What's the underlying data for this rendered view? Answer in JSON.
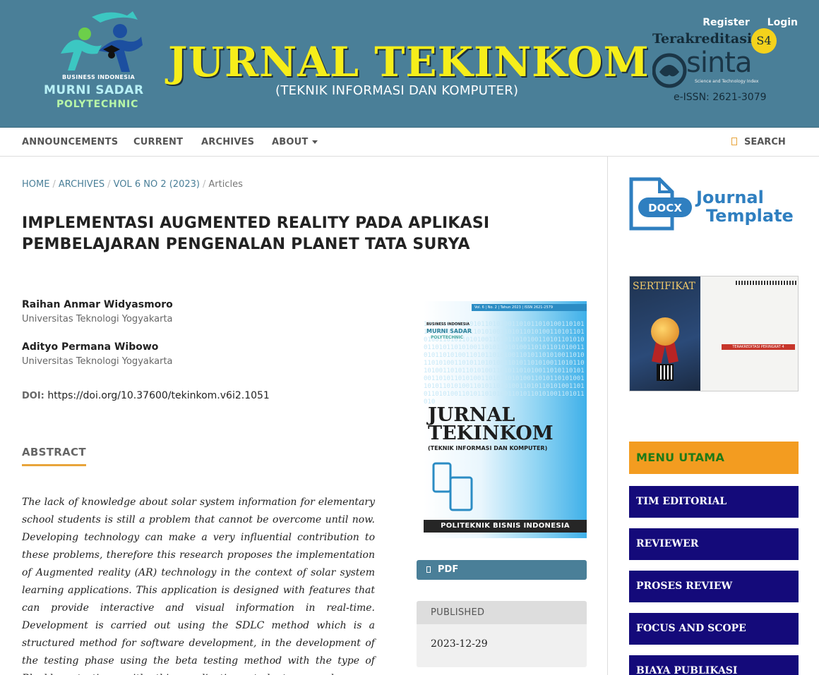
{
  "header": {
    "institution": {
      "line1": "BUSINESS INDONESIA",
      "line2": "MURNI SADAR",
      "line3": "POLYTECHNIC"
    },
    "journal_title": "JURNAL TEKINKOM",
    "journal_subtitle": "(TEKNIK INFORMASI DAN KOMPUTER)",
    "register_label": "Register",
    "login_label": "Login",
    "accreditation": {
      "label": "Terakreditasi",
      "badge": "S4",
      "sinta_word": "sinta",
      "sinta_tagline": "Science and Technology Index",
      "issn": "e-ISSN: 2621-3079"
    }
  },
  "nav": {
    "items": [
      "ANNOUNCEMENTS",
      "CURRENT",
      "ARCHIVES",
      "ABOUT"
    ],
    "search_label": "SEARCH"
  },
  "breadcrumb": {
    "home": "HOME",
    "archives": "ARCHIVES",
    "issue": "VOL 6 NO 2 (2023)",
    "section": "Articles"
  },
  "article": {
    "title": "IMPLEMENTASI AUGMENTED REALITY PADA APLIKASI PEMBELAJARAN PENGENALAN PLANET TATA SURYA",
    "authors": [
      {
        "name": "Raihan Anmar Widyasmoro",
        "affiliation": "Universitas Teknologi Yogyakarta"
      },
      {
        "name": "Adityo Permana Wibowo",
        "affiliation": "Universitas Teknologi Yogyakarta"
      }
    ],
    "doi_label": "DOI:",
    "doi_value": "https://doi.org/10.37600/tekinkom.v6i2.1051",
    "abstract_heading": "ABSTRACT",
    "abstract_text": "The lack of knowledge about solar system information for elementary school students is still a problem that cannot be overcome until now. Developing technology can make a very influential contribution to these problems, therefore this research proposes the implementation of Augmented reality (AR) technology in the context of solar system learning applications. This application is designed with features that can provide interactive and visual information in real-time. Development is carried out using the SDLC method which is a structured method for software development, in the development of the testing phase using the beta testing method with the type of Blackbox testing, with this application students can do more interesting and effective"
  },
  "cover": {
    "topbar": "Vol. 6 | No. 2 | Tahun 2023 | ISSN 2621-2579",
    "logo_top": "BUSINESS INDONESIA",
    "logo_main": "MURNI SADAR",
    "logo_sub": "POLYTECHNIC",
    "title_line1": "JURNAL",
    "title_line2": "TEKINKOM",
    "subtitle": "(TEKNIK INFORMASI DAN KOMPUTER)",
    "footer": "POLITEKNIK BISNIS INDONESIA"
  },
  "galley": {
    "pdf_label": "PDF"
  },
  "published": {
    "label": "PUBLISHED",
    "date": "2023-12-29"
  },
  "sidebar": {
    "template": {
      "badge": "DOCX",
      "line1": "Journal",
      "line2": "Template"
    },
    "certificate": {
      "title": "SERTIFIKAT",
      "accreditation": "TERAKREDITASI PERINGKAT 4"
    },
    "menu_heading": "MENU UTAMA",
    "menu_items": [
      "TIM EDITORIAL",
      "REVIEWER",
      "PROSES REVIEW",
      "FOCUS AND SCOPE",
      "BIAYA PUBLIKASI"
    ]
  },
  "colors": {
    "header_bg": "#4a7f98",
    "brand_yellow": "#f6ee1a",
    "accent_orange": "#e8a43a",
    "menu_heading_bg": "#f39c20",
    "menu_item_bg": "#140a7a"
  }
}
